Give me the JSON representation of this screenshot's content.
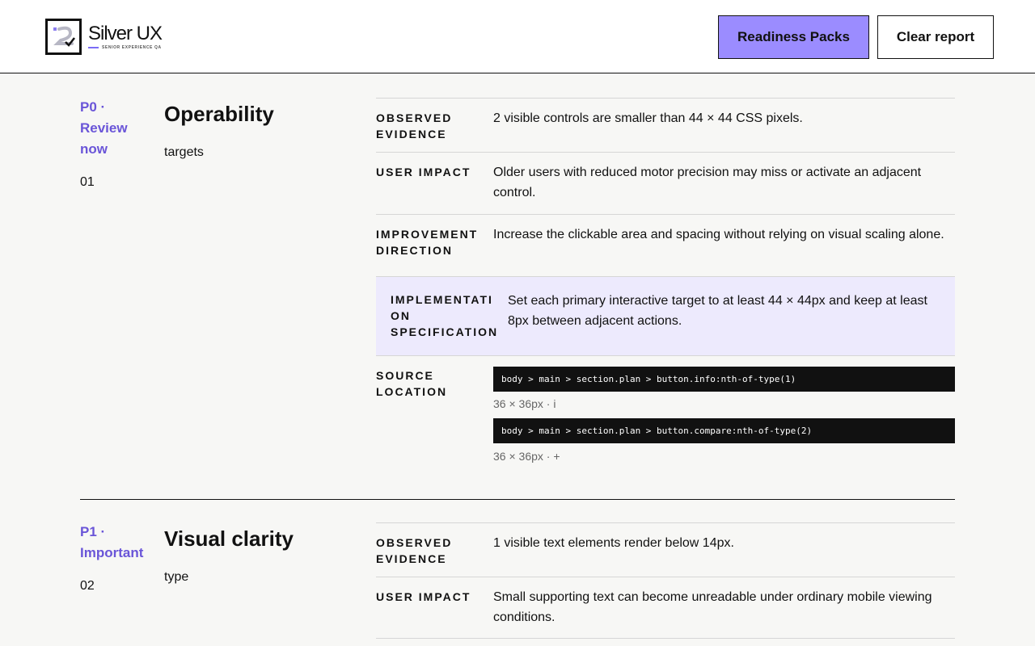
{
  "header": {
    "logo_name": "Silver UX",
    "logo_sub": "SENIOR EXPERIENCE QA",
    "readiness_label": "Readiness Packs",
    "clear_label": "Clear report"
  },
  "colors": {
    "accent": "#9b8cff",
    "priority": "#6a55d8",
    "spec_bg": "#edeafd"
  },
  "issues": [
    {
      "priority_lines": [
        "P0 ·",
        "Review",
        "now"
      ],
      "number": "01",
      "title": "Operability",
      "tag": "targets",
      "observed_label": [
        "OBSERVED",
        "EVIDENCE"
      ],
      "observed": "2 visible controls are smaller than 44 × 44 CSS pixels.",
      "impact_label": "USER IMPACT",
      "impact": "Older users with reduced motor precision may miss or activate an adjacent control.",
      "direction_label": [
        "IMPROVEMENT",
        "DIRECTION"
      ],
      "direction": "Increase the clickable area and spacing without relying on visual scaling alone.",
      "spec_label": [
        "IMPLEMENTATI",
        "ON",
        "SPECIFICATION"
      ],
      "spec": "Set each primary interactive target to at least 44 × 44px and keep at least 8px between adjacent actions.",
      "source_label": [
        "SOURCE",
        "LOCATION"
      ],
      "sources": [
        {
          "selector": "body > main > section.plan > button.info:nth-of-type(1)",
          "meta": "36 × 36px · i"
        },
        {
          "selector": "body > main > section.plan > button.compare:nth-of-type(2)",
          "meta": "36 × 36px · +"
        }
      ]
    },
    {
      "priority_lines": [
        "P1 ·",
        "Important"
      ],
      "number": "02",
      "title": "Visual clarity",
      "tag": "type",
      "observed_label": [
        "OBSERVED",
        "EVIDENCE"
      ],
      "observed": "1 visible text elements render below 14px.",
      "impact_label": "USER IMPACT",
      "impact": "Small supporting text can become unreadable under ordinary mobile viewing conditions."
    }
  ]
}
